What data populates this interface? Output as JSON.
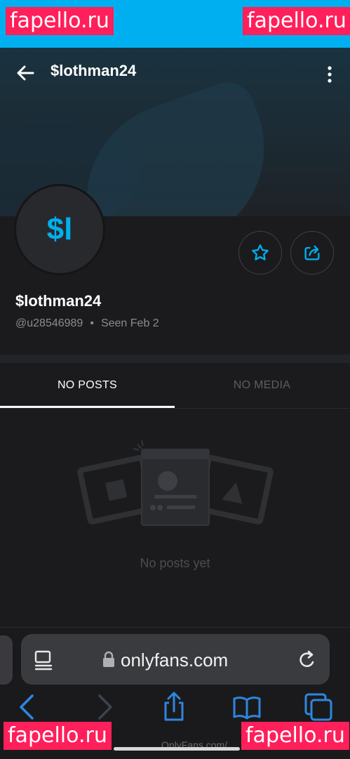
{
  "status_bar": {
    "watermark_left": "fapello.ru",
    "watermark_right": "fapello.ru"
  },
  "header": {
    "title": "$lothman24"
  },
  "profile": {
    "avatar_initials": "$l",
    "name": "$lothman24",
    "handle": "@u28546989",
    "separator": "•",
    "seen_label": "Seen",
    "seen_date": "Feb 2"
  },
  "tabs": [
    {
      "label": "NO POSTS",
      "active": true
    },
    {
      "label": "NO MEDIA",
      "active": false
    }
  ],
  "empty_state": {
    "message": "No posts yet"
  },
  "browser": {
    "url": "onlyfans.com",
    "footer": "OnlyFans.com/",
    "watermark_left": "fapello.ru",
    "watermark_right": "fapello.ru"
  },
  "colors": {
    "accent": "#00aff0",
    "watermark": "#ff1f5a",
    "background": "#1b1b1d"
  }
}
